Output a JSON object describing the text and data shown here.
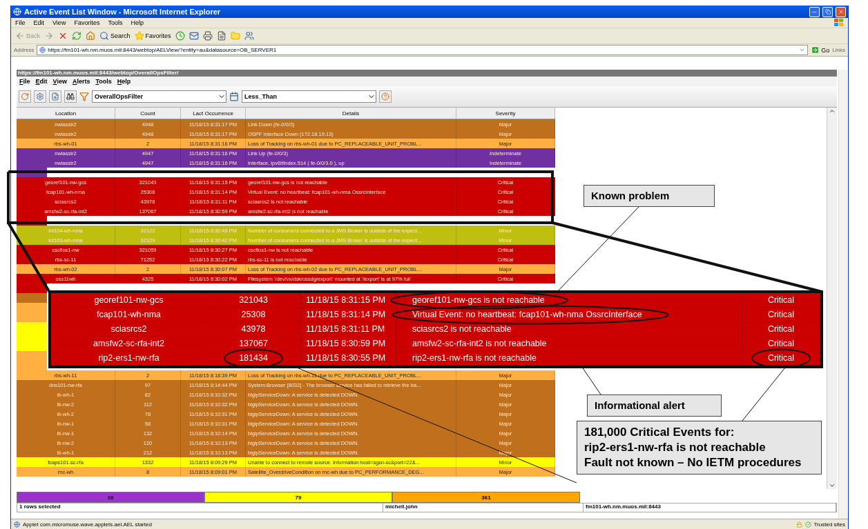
{
  "window": {
    "title": "Active Event List Window - Microsoft Internet Explorer"
  },
  "menu": [
    "File",
    "Edit",
    "View",
    "Favorites",
    "Tools",
    "Help"
  ],
  "toolbar": {
    "back": "Back",
    "search": "Search",
    "favorites": "Favorites"
  },
  "address": {
    "label": "Address",
    "value": "https://fm101-wh.nm.muos.mil:8443/webtop/AELView/?entity=au&datasource=OB_SERVER1",
    "go": "Go",
    "links": "Links"
  },
  "applet": {
    "url": "https://fm101-wh.nm.muos.mil:8443/webtop/OverallOpsFilter/",
    "menu": [
      "File",
      "Edit",
      "View",
      "Alerts",
      "Tools",
      "Help"
    ],
    "filter": "OverallOpsFilter",
    "view": "Less_Than",
    "columns": [
      "Location",
      "Count",
      "Lact Occurrence",
      "Details",
      "Severity"
    ],
    "rows": [
      {
        "cells": [
          "nwiassir2",
          "4948",
          "11/18/15 8:31:17 PM",
          "Link Down  (fe-0/0/3)",
          "Major"
        ],
        "color": "#c0701c"
      },
      {
        "cells": [
          "nwiassir2",
          "4948",
          "11/18/15 8:31:17 PM",
          "OSPF Interface Down  (172.18.19.13)",
          "Major"
        ],
        "color": "#c0701c"
      },
      {
        "cells": [
          "rbs-wh-01",
          "2",
          "11/18/15 8:31:16 PM",
          "Loss of Tracking on rbs-wh-01 due to PC_REPLACEABLE_UNIT_PROBL...",
          "Major"
        ],
        "color": "#ffb040"
      },
      {
        "cells": [
          "nwiassir2",
          "4947",
          "11/18/15 8:31:16 PM",
          "Link Up  (fe-0/0/3)",
          "Indeterminate"
        ],
        "color": "#7030a0"
      },
      {
        "cells": [
          "nwiassir2",
          "4947",
          "11/18/15 8:31:16 PM",
          "Interface, ipv6IfIndex.514 ( fe-0/0/3.0 ), up",
          "Indeterminate"
        ],
        "color": "#7030a0"
      },
      {
        "color": "#7030a0"
      },
      {
        "cells": [
          "georef101-nw-gcs",
          "321043",
          "11/18/15 8:31:15 PM",
          "georef101-nw-gcs is not reachable",
          "Critical"
        ],
        "color": "#cc0000"
      },
      {
        "cells": [
          "fcap101-wh-nma",
          "25308",
          "11/18/15 8:31:14 PM",
          "Virtual Event: no heartbeat: fcap101-wh-nma OssrcInterface",
          "Critical"
        ],
        "color": "#cc0000"
      },
      {
        "cells": [
          "sciasrcs2",
          "43978",
          "11/18/15 8:31:11 PM",
          "sciasrcs2 is not reachable",
          "Critical"
        ],
        "color": "#cc0000"
      },
      {
        "cells": [
          "amsfw2-sc-rfa-int2",
          "137067",
          "11/18/15 8:30:59 PM",
          "amsfw2-sc-rfa-int2 is not reachable",
          "Critical"
        ],
        "color": "#cc0000"
      },
      {
        "color": "#cc0000"
      },
      {
        "cells": [
          "inf104-wh-nma",
          "32122",
          "11/18/15 8:30:49 PM",
          "Number of consumers connected to a JMS Broker is outside of the expect...",
          "Minor"
        ],
        "color": "#bfbf10"
      },
      {
        "cells": [
          "inf103-wh-nma",
          "32129",
          "11/18/15 8:30:42 PM",
          "Number of consumers connected to a JMS Broker is outside of the expect...",
          "Minor"
        ],
        "color": "#bfbf10"
      },
      {
        "cells": [
          "cscflos1-nw",
          "321059",
          "11/18/15 8:30:27 PM",
          "cscflos1-nw is not reachable",
          "Critical"
        ],
        "color": "#cc0000"
      },
      {
        "cells": [
          "rbs-sc-11",
          "71252",
          "11/18/15 8:30:22 PM",
          "rbs-sc-11 is not reachable",
          "Critical"
        ],
        "color": "#cc0000"
      },
      {
        "cells": [
          "rbs-wh-02",
          "2",
          "11/18/15 8:30:07 PM",
          "Loss of Tracking on rbs-wh-02 due to PC_REPLACEABLE_UNIT_PROBL...",
          "Major"
        ],
        "color": "#ffb040"
      },
      {
        "cells": [
          "oss11wh",
          "4325",
          "11/18/15 8:30:02 PM",
          "Filesystem '/dev/vx/dsk/ossdg/export' mounted at '/export' is at 97% full",
          "Critical"
        ],
        "color": "#cc0000"
      },
      {
        "color": "#cc0000"
      },
      {
        "color": "#c0701c"
      },
      {
        "color": "#ffb040"
      },
      {
        "color": "#ffb040"
      },
      {
        "color": "#ffff00"
      },
      {
        "color": "#ffff00"
      },
      {
        "color": "#ffff00"
      },
      {
        "color": "#ffb040"
      },
      {
        "color": "#ffb040"
      },
      {
        "cells": [
          "rbs-wh-11",
          "2",
          "11/18/15 8:18:39 PM",
          "Loss of Tracking on rbs-wh-11 due to PC_REPLACEABLE_UNIT_PROBL...",
          "Major"
        ],
        "color": "#ffb040"
      },
      {
        "cells": [
          "dns101-nw-rfa",
          "97",
          "11/18/15 8:14:44 PM",
          "System:Browser [8032] - The browser service has failed to retrieve the ba...",
          "Major"
        ],
        "color": "#c0701c"
      },
      {
        "cells": [
          "lb-wh-1",
          "82",
          "11/18/15 8:10:32 PM",
          "bigipServiceDown: A service is detected DOWN.",
          "Major"
        ],
        "color": "#c0701c"
      },
      {
        "cells": [
          "lb-nw-2",
          "112",
          "11/18/15 8:10:32 PM",
          "bigipServiceDown: A service is detected DOWN.",
          "Major"
        ],
        "color": "#c0701c"
      },
      {
        "cells": [
          "lb-wh-2",
          "78",
          "11/18/15 8:10:31 PM",
          "bigipServiceDown: A service is detected DOWN.",
          "Major"
        ],
        "color": "#c0701c"
      },
      {
        "cells": [
          "lb-nw-1",
          "58",
          "11/18/15 8:10:31 PM",
          "bigipServiceDown: A service is detected DOWN.",
          "Major"
        ],
        "color": "#c0701c"
      },
      {
        "cells": [
          "lb-nw-1",
          "132",
          "11/18/15 8:10:14 PM",
          "bigipServiceDown: A service is detected DOWN.",
          "Major"
        ],
        "color": "#c0701c"
      },
      {
        "cells": [
          "lb-nw-2",
          "120",
          "11/18/15 8:10:13 PM",
          "bigipServiceDown: A service is detected DOWN.",
          "Major"
        ],
        "color": "#c0701c"
      },
      {
        "cells": [
          "lb-wh-1",
          "212",
          "11/18/15 8:10:13 PM",
          "bigipServiceDown: A service is detected DOWN.",
          "Major"
        ],
        "color": "#c0701c"
      },
      {
        "cells": [
          "fcaps101-sc-rfa",
          "1332",
          "11/18/15 8:09:29 PM",
          "Unable to connect to remote source. Information:host=sgsn-sc&port=22&...",
          "Minor"
        ],
        "color": "#ffff00"
      },
      {
        "cells": [
          "rnc-wh",
          "8",
          "11/18/15 8:09:01 PM",
          "Satellite_OverdriveCondition on rnc-wh due to PC_PERFORMANCE_DEG...",
          "Major"
        ],
        "color": "#ffb040"
      }
    ],
    "summary": [
      {
        "count": "18",
        "color": "#9933cc"
      },
      {
        "count": "79",
        "color": "#ffff00"
      },
      {
        "count": "361",
        "color": "#ffa500"
      }
    ],
    "status": {
      "selection": "1 rows selected",
      "user": "michell.john",
      "server": "fm101-wh.nm.muos.mil:8443"
    }
  },
  "zoom_inset": {
    "rows": [
      {
        "cells": [
          "georef101-nw-gcs",
          "321043",
          "11/18/15 8:31:15 PM",
          "georef101-nw-gcs is not reachable",
          "Critical"
        ]
      },
      {
        "cells": [
          "fcap101-wh-nma",
          "25308",
          "11/18/15 8:31:14 PM",
          "Virtual Event: no heartbeat: fcap101-wh-nma OssrcInterface",
          "Critical"
        ]
      },
      {
        "cells": [
          "sciasrcs2",
          "43978",
          "11/18/15 8:31:11 PM",
          "sciasrcs2 is not reachable",
          "Critical"
        ]
      },
      {
        "cells": [
          "amsfw2-sc-rfa-int2",
          "137067",
          "11/18/15 8:30:59 PM",
          "amsfw2-sc-rfa-int2 is not reachable",
          "Critical"
        ]
      },
      {
        "cells": [
          "rip2-ers1-nw-rfa",
          "181434",
          "11/18/15 8:30:55 PM",
          "rip2-ers1-nw-rfa is not reachable",
          "Critical"
        ]
      }
    ]
  },
  "callouts": [
    {
      "lines": [
        "Known problem"
      ]
    },
    {
      "lines": [
        "Informational alert"
      ]
    },
    {
      "lines": [
        "181,000 Critical Events for:",
        "rip2-ers1-nw-rfa is not reachable",
        "Fault not known – No IETM procedures"
      ]
    }
  ],
  "status_bar": {
    "message": "Applet com.micromuse.wave.applets.ael.AEL started",
    "zone": "Trusted sites"
  }
}
